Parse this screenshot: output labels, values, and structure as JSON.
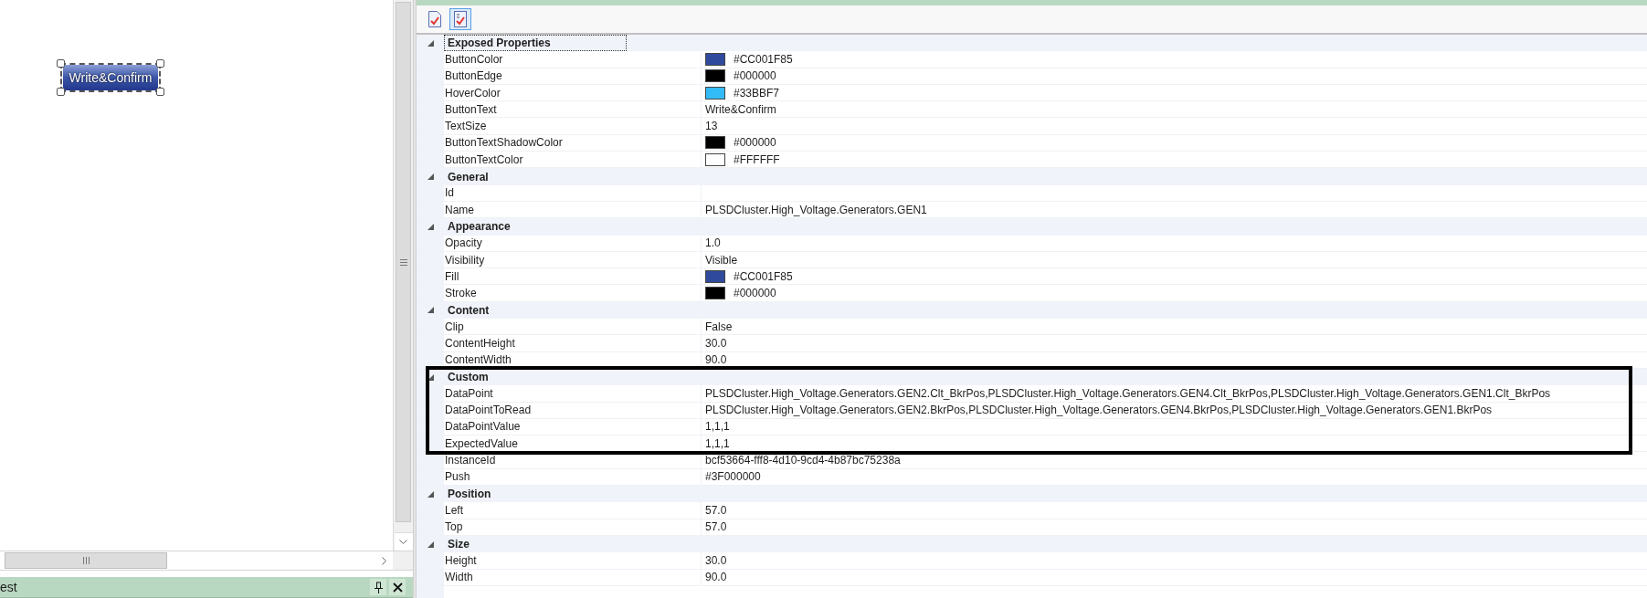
{
  "canvas": {
    "button": {
      "label": "Write&Confirm",
      "selected": true
    }
  },
  "bottom_panel": {
    "title": "est"
  },
  "properties": {
    "toolbar": [
      {
        "kind": "page",
        "selected": false
      },
      {
        "kind": "list",
        "selected": true
      }
    ],
    "categories": [
      {
        "name": "Exposed Properties",
        "expanded": true,
        "selected": true,
        "highlighted": false,
        "properties": [
          {
            "name": "ButtonColor",
            "value": "#CC001F85",
            "color": "#2f4a9c"
          },
          {
            "name": "ButtonEdge",
            "value": "#000000",
            "color": "#000000"
          },
          {
            "name": "HoverColor",
            "value": "#33BBF7",
            "color": "#33bbf7"
          },
          {
            "name": "ButtonText",
            "value": "Write&Confirm"
          },
          {
            "name": "TextSize",
            "value": "13"
          },
          {
            "name": "ButtonTextShadowColor",
            "value": "#000000",
            "color": "#000000"
          },
          {
            "name": "ButtonTextColor",
            "value": "#FFFFFF",
            "color": "#ffffff"
          }
        ]
      },
      {
        "name": "General",
        "expanded": true,
        "selected": false,
        "highlighted": false,
        "properties": [
          {
            "name": "Id"
          },
          {
            "name": "Name",
            "value": "PLSDCluster.High_Voltage.Generators.GEN1"
          }
        ]
      },
      {
        "name": "Appearance",
        "expanded": true,
        "selected": false,
        "highlighted": false,
        "properties": [
          {
            "name": "Opacity",
            "value": "1.0"
          },
          {
            "name": "Visibility",
            "value": "Visible"
          },
          {
            "name": "Fill",
            "value": "#CC001F85",
            "color": "#2f4a9c"
          },
          {
            "name": "Stroke",
            "value": "#000000",
            "color": "#000000"
          }
        ]
      },
      {
        "name": "Content",
        "expanded": true,
        "selected": false,
        "highlighted": false,
        "properties": [
          {
            "name": "Clip",
            "value": "False"
          },
          {
            "name": "ContentHeight",
            "value": "30.0"
          },
          {
            "name": "ContentWidth",
            "value": "90.0"
          }
        ]
      },
      {
        "name": "Custom",
        "expanded": true,
        "selected": false,
        "highlighted": true,
        "properties": [
          {
            "name": "DataPoint",
            "value": "PLSDCluster.High_Voltage.Generators.GEN2.Clt_BkrPos,PLSDCluster.High_Voltage.Generators.GEN4.Clt_BkrPos,PLSDCluster.High_Voltage.Generators.GEN1.Clt_BkrPos"
          },
          {
            "name": "DataPointToRead",
            "value": "PLSDCluster.High_Voltage.Generators.GEN2.BkrPos,PLSDCluster.High_Voltage.Generators.GEN4.BkrPos,PLSDCluster.High_Voltage.Generators.GEN1.BkrPos"
          },
          {
            "name": "DataPointValue",
            "value": "1,1,1"
          },
          {
            "name": "ExpectedValue",
            "value": "1,1,1"
          }
        ],
        "after": [
          {
            "name": "InstanceId",
            "value": "bcf53664-fff8-4d10-9cd4-4b87bc75238a"
          },
          {
            "name": "Push",
            "value": "#3F000000"
          }
        ]
      },
      {
        "name": "Position",
        "expanded": true,
        "selected": false,
        "highlighted": false,
        "properties": [
          {
            "name": "Left",
            "value": "57.0"
          },
          {
            "name": "Top",
            "value": "57.0"
          }
        ]
      },
      {
        "name": "Size",
        "expanded": true,
        "selected": false,
        "highlighted": false,
        "properties": [
          {
            "name": "Height",
            "value": "30.0"
          },
          {
            "name": "Width",
            "value": "90.0"
          }
        ]
      }
    ]
  }
}
